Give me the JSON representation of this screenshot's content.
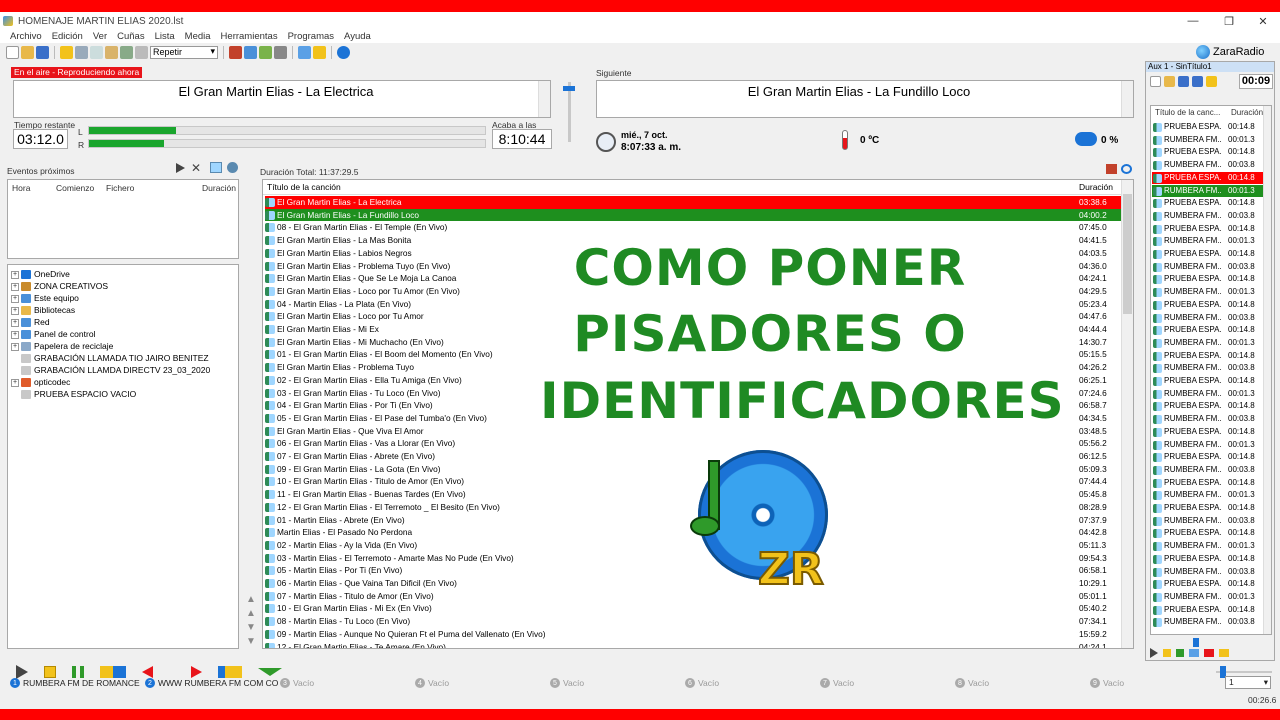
{
  "window": {
    "title": "HOMENAJE MARTIN ELIAS 2020.lst",
    "min": "—",
    "max": "❐",
    "close": "✕"
  },
  "menu": [
    "Archivo",
    "Edición",
    "Ver",
    "Cuñas",
    "Lista",
    "Media",
    "Herramientas",
    "Programas",
    "Ayuda"
  ],
  "toolbar": {
    "repeat_select": "Repetir"
  },
  "brand": "ZaraRadio",
  "on_air": {
    "badge": "En el aire - Reproduciendo ahora",
    "song": "El Gran Martin Elias - La Electrica",
    "remaining_label": "Tiempo restante",
    "remaining": "03:12.0",
    "ends_label": "Acaba a las",
    "ends_at": "8:10:44",
    "meter_L": "L",
    "meter_R": "R",
    "level_L_pct": 22,
    "level_R_pct": 19
  },
  "next": {
    "label": "Siguiente",
    "song": "El Gran Martin Elias - La Fundillo Loco"
  },
  "clock": {
    "date": "mié., 7 oct.",
    "time": "8:07:33 a. m.",
    "temperature": "0 ºC",
    "humidity": "0 %"
  },
  "events": {
    "label": "Eventos próximos",
    "cols": [
      "Hora",
      "Comienzo",
      "Fichero",
      "Duración"
    ]
  },
  "tree": [
    {
      "label": "OneDrive",
      "exp": "+",
      "color": "#1b73d6"
    },
    {
      "label": "ZONA CREATIVOS",
      "exp": "+",
      "color": "#c98b2b"
    },
    {
      "label": "Este equipo",
      "exp": "+",
      "color": "#4a90d9"
    },
    {
      "label": "Bibliotecas",
      "exp": "+",
      "color": "#e8b84a"
    },
    {
      "label": "Red",
      "exp": "+",
      "color": "#4a90d9"
    },
    {
      "label": "Panel de control",
      "exp": "+",
      "color": "#4a90d9"
    },
    {
      "label": "Papelera de reciclaje",
      "exp": "+",
      "color": "#8aa8c8"
    },
    {
      "label": "GRABACIÓN LLAMADA TIO JAIRO BENITEZ",
      "exp": "",
      "color": "#c8c8c8"
    },
    {
      "label": "GRABACIÓN LLAMDA DIRECTV 23_03_2020",
      "exp": "",
      "color": "#c8c8c8"
    },
    {
      "label": "opticodec",
      "exp": "+",
      "color": "#e05b2a"
    },
    {
      "label": "PRUEBA ESPACIO VACIO",
      "exp": "",
      "color": "#c8c8c8"
    }
  ],
  "playlist": {
    "total_label": "Duración Total: 11:37:29.5",
    "col_title": "Título de la canción",
    "col_duration": "Duración",
    "rows": [
      {
        "t": "El Gran Martin Elias - La Electrica",
        "d": "03:38.6",
        "state": "red"
      },
      {
        "t": "El Gran Martin Elias - La Fundillo Loco",
        "d": "04:00.2",
        "state": "green"
      },
      {
        "t": "08 - El Gran Martin Elias - El Temple (En Vivo)",
        "d": "07:45.0"
      },
      {
        "t": "El Gran Martin Elias - La Mas Bonita",
        "d": "04:41.5"
      },
      {
        "t": "El Gran Martin Elias - Labios Negros",
        "d": "04:03.5"
      },
      {
        "t": "El Gran Martin Elias - Problema Tuyo (En Vivo)",
        "d": "04:36.0"
      },
      {
        "t": "El Gran Martin Elias - Que Se Le Moja La Canoa",
        "d": "04:24.1"
      },
      {
        "t": "El Gran Martin Elias - Loco por Tu Amor (En Vivo)",
        "d": "04:29.5"
      },
      {
        "t": "04 - Martin Elias - La Plata (En Vivo)",
        "d": "05:23.4"
      },
      {
        "t": "El Gran Martin Elias - Loco por Tu Amor",
        "d": "04:47.6"
      },
      {
        "t": "El Gran Martin Elias - Mi Ex",
        "d": "04:44.4"
      },
      {
        "t": "El Gran Martin Elias - Mi Muchacho (En Vivo)",
        "d": "14:30.7"
      },
      {
        "t": "01 - El Gran Martin Elias - El Boom del Momento (En Vivo)",
        "d": "05:15.5"
      },
      {
        "t": "El Gran Martin Elias - Problema Tuyo",
        "d": "04:26.2"
      },
      {
        "t": "02 - El Gran Martin Elias - Ella Tu Amiga (En Vivo)",
        "d": "06:25.1"
      },
      {
        "t": "03 - El Gran Martin Elias - Tu Loco (En Vivo)",
        "d": "07:24.6"
      },
      {
        "t": "04 - El Gran Martin Elias - Por Ti (En Vivo)",
        "d": "06:58.7"
      },
      {
        "t": "05 - El Gran Martin Elias - El Pase del Tumba'o (En Vivo)",
        "d": "04:34.5"
      },
      {
        "t": "El Gran Martin Elias - Que Viva El Amor",
        "d": "03:48.5"
      },
      {
        "t": "06 - El Gran Martin Elias - Vas a Llorar (En Vivo)",
        "d": "05:56.2"
      },
      {
        "t": "07 - El Gran Martin Elias - Abrete (En Vivo)",
        "d": "06:12.5"
      },
      {
        "t": "09 - El Gran Martin Elias - La Gota (En Vivo)",
        "d": "05:09.3"
      },
      {
        "t": "10 - El Gran Martin Elias - Titulo de Amor (En Vivo)",
        "d": "07:44.4"
      },
      {
        "t": "11 - El Gran Martin Elias - Buenas Tardes (En Vivo)",
        "d": "05:45.8"
      },
      {
        "t": "12 - El Gran Martin Elias - El Terremoto _ El Besito (En Vivo)",
        "d": "08:28.9"
      },
      {
        "t": "01 - Martin Elias - Abrete (En Vivo)",
        "d": "07:37.9"
      },
      {
        "t": "Martin Elias - El Pasado No Perdona",
        "d": "04:42.8"
      },
      {
        "t": "02 - Martin Elias - Ay la Vida (En Vivo)",
        "d": "05:11.3"
      },
      {
        "t": "03 - Martin Elias - El Terremoto - Amarte Mas No Pude (En Vivo)",
        "d": "09:54.3"
      },
      {
        "t": "05 - Martin Elias - Por Ti (En Vivo)",
        "d": "06:58.1"
      },
      {
        "t": "06 - Martin Elias - Que Vaina Tan Dificil (En Vivo)",
        "d": "10:29.1"
      },
      {
        "t": "07 - Martin Elias - Titulo de Amor (En Vivo)",
        "d": "05:01.1"
      },
      {
        "t": "10 - El Gran Martin Elias - Mi Ex (En Vivo)",
        "d": "05:40.2"
      },
      {
        "t": "08 - Martin Elias - Tu Loco (En Vivo)",
        "d": "07:34.1"
      },
      {
        "t": "09 - Martin Elias - Aunque No Quieran Ft el Puma del Vallenato (En Vivo)",
        "d": "15:59.2"
      },
      {
        "t": "12 - El Gran Martin Elias - Te Amare (En Vivo)",
        "d": "04:24.1"
      }
    ]
  },
  "overlay": {
    "line1": "COMO PONER",
    "line2": "PISADORES O",
    "line3": "IDENTIFICADORES",
    "logo_text": "ZR"
  },
  "aux": {
    "title": "Aux 1 - SinTítulo1",
    "timer": "00:09",
    "col_title": "Título de la canc...",
    "col_duration": "Duración",
    "rows": [
      {
        "t": "PRUEBA ESPA...",
        "d": "00:14.8"
      },
      {
        "t": "RUMBERA FM...",
        "d": "00:01.3"
      },
      {
        "t": "PRUEBA ESPA...",
        "d": "00:14.8"
      },
      {
        "t": "RUMBERA FM...",
        "d": "00:03.8"
      },
      {
        "t": "PRUEBA ESPA...",
        "d": "00:14.8",
        "state": "red"
      },
      {
        "t": "RUMBERA FM...",
        "d": "00:01.3",
        "state": "green"
      },
      {
        "t": "PRUEBA ESPA...",
        "d": "00:14.8"
      },
      {
        "t": "RUMBERA FM...",
        "d": "00:03.8"
      },
      {
        "t": "PRUEBA ESPA...",
        "d": "00:14.8"
      },
      {
        "t": "RUMBERA FM...",
        "d": "00:01.3"
      },
      {
        "t": "PRUEBA ESPA...",
        "d": "00:14.8"
      },
      {
        "t": "RUMBERA FM...",
        "d": "00:03.8"
      },
      {
        "t": "PRUEBA ESPA...",
        "d": "00:14.8"
      },
      {
        "t": "RUMBERA FM...",
        "d": "00:01.3"
      },
      {
        "t": "PRUEBA ESPA...",
        "d": "00:14.8"
      },
      {
        "t": "RUMBERA FM...",
        "d": "00:03.8"
      },
      {
        "t": "PRUEBA ESPA...",
        "d": "00:14.8"
      },
      {
        "t": "RUMBERA FM...",
        "d": "00:01.3"
      },
      {
        "t": "PRUEBA ESPA...",
        "d": "00:14.8"
      },
      {
        "t": "RUMBERA FM...",
        "d": "00:03.8"
      },
      {
        "t": "PRUEBA ESPA...",
        "d": "00:14.8"
      },
      {
        "t": "RUMBERA FM...",
        "d": "00:01.3"
      },
      {
        "t": "PRUEBA ESPA...",
        "d": "00:14.8"
      },
      {
        "t": "RUMBERA FM...",
        "d": "00:03.8"
      },
      {
        "t": "PRUEBA ESPA...",
        "d": "00:14.8"
      },
      {
        "t": "RUMBERA FM...",
        "d": "00:01.3"
      },
      {
        "t": "PRUEBA ESPA...",
        "d": "00:14.8"
      },
      {
        "t": "RUMBERA FM...",
        "d": "00:03.8"
      },
      {
        "t": "PRUEBA ESPA...",
        "d": "00:14.8"
      },
      {
        "t": "RUMBERA FM...",
        "d": "00:01.3"
      },
      {
        "t": "PRUEBA ESPA...",
        "d": "00:14.8"
      },
      {
        "t": "RUMBERA FM...",
        "d": "00:03.8"
      },
      {
        "t": "PRUEBA ESPA...",
        "d": "00:14.8"
      },
      {
        "t": "RUMBERA FM...",
        "d": "00:01.3"
      },
      {
        "t": "PRUEBA ESPA...",
        "d": "00:14.8"
      },
      {
        "t": "RUMBERA FM...",
        "d": "00:03.8"
      },
      {
        "t": "PRUEBA ESPA...",
        "d": "00:14.8"
      },
      {
        "t": "RUMBERA FM...",
        "d": "00:01.3"
      },
      {
        "t": "PRUEBA ESPA...",
        "d": "00:14.8"
      },
      {
        "t": "RUMBERA FM...",
        "d": "00:03.8"
      }
    ]
  },
  "status": {
    "slot1": "RUMBERA FM DE ROMANCE",
    "slot2": "WWW RUMBERA FM COM CO",
    "empty": "Vacío",
    "select": "1",
    "elapsed": "00:26.6"
  }
}
